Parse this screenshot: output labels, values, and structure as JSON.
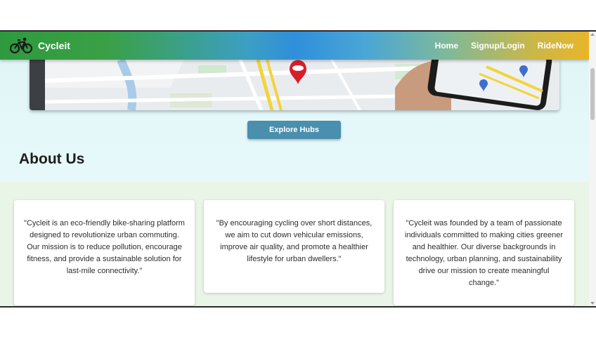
{
  "navbar": {
    "brand_name": "Cycleit",
    "brand_icon": "bicycle-icon",
    "links": [
      {
        "label": "Home"
      },
      {
        "label": "Signup/Login"
      },
      {
        "label": "RideNow"
      }
    ],
    "gradient_colors": [
      "#2e9a3e",
      "#2f8fdb",
      "#e9b52a"
    ]
  },
  "hero": {
    "image_semantic": "city map with location pin and phone showing map",
    "explore_button": "Explore Hubs"
  },
  "about": {
    "title": "About Us",
    "cards": [
      {
        "text": "\"Cycleit is an eco-friendly bike-sharing platform designed to revolutionize urban commuting. Our mission is to reduce pollution, encourage fitness, and provide a sustainable solution for last-mile connectivity.\""
      },
      {
        "text": "\"By encouraging cycling over short distances, we aim to cut down vehicular emissions, improve air quality, and promote a healthier lifestyle for urban dwellers.\""
      },
      {
        "text": "\"Cycleit was founded by a team of passionate individuals committed to making cities greener and healthier. Our diverse backgrounds in technology, urban planning, and sustainability drive our mission to create meaningful change.\""
      }
    ]
  },
  "colors": {
    "button": "#4a8fad",
    "about_background": "#e9f5e6",
    "hero_background": "#e4f7f9"
  }
}
